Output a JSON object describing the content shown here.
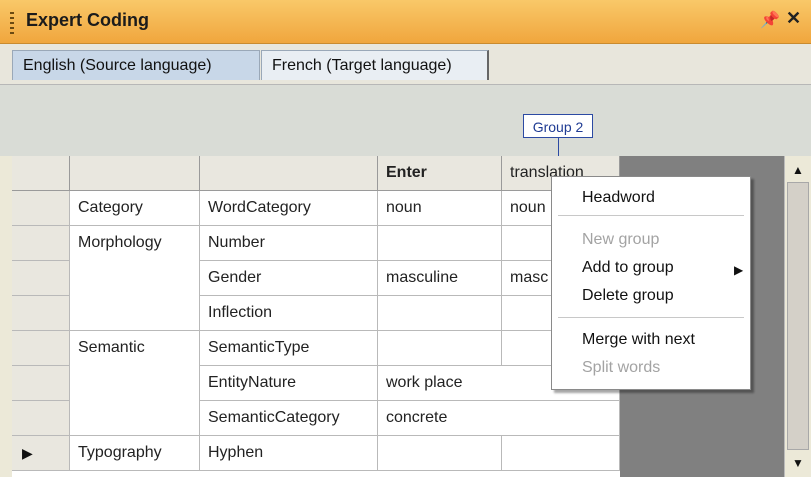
{
  "window": {
    "title": "Expert Coding",
    "pin_glyph": "1",
    "close_glyph": "✕"
  },
  "tabs": [
    {
      "label": "English (Source language)",
      "selected": true
    },
    {
      "label": "French (Target language)",
      "selected": false
    }
  ],
  "group_label": "Group 2",
  "grid": {
    "headers": [
      "",
      "",
      "",
      "Enter",
      "translation"
    ],
    "rows": [
      {
        "category": "Category",
        "attribute": "WordCategory",
        "source": "noun",
        "target": "noun",
        "pointer": false
      },
      {
        "category": "Morphology",
        "attribute": "Number",
        "source": "",
        "target": "",
        "pointer": false
      },
      {
        "category": "",
        "attribute": "Gender",
        "source": "masculine",
        "target": "masc",
        "pointer": false
      },
      {
        "category": "",
        "attribute": "Inflection",
        "source": "",
        "target": "",
        "pointer": false
      },
      {
        "category": "Semantic",
        "attribute": "SemanticType",
        "source": "",
        "target": "",
        "pointer": false
      },
      {
        "category": "",
        "attribute": "EntityNature",
        "source": "work place",
        "target": "",
        "pointer": false
      },
      {
        "category": "",
        "attribute": "SemanticCategory",
        "source": "concrete",
        "target": "",
        "pointer": false
      },
      {
        "category": "Typography",
        "attribute": "Hyphen",
        "source": "",
        "target": "",
        "pointer": true
      }
    ]
  },
  "context_menu": {
    "items": [
      {
        "label": "Headword",
        "disabled": false
      },
      {
        "label": "New group",
        "disabled": true
      },
      {
        "label": "Add to group",
        "disabled": false,
        "submenu": true
      },
      {
        "label": "Delete group",
        "disabled": false
      },
      {
        "label": "Merge with next",
        "disabled": false
      },
      {
        "label": "Split words",
        "disabled": true
      }
    ]
  },
  "icons": {
    "pointer": "▶",
    "submenu": "▶",
    "up": "▲",
    "down": "▼"
  },
  "colors": {
    "titlebar": "#f0a63d",
    "group_border": "#2c4aa3",
    "selected_tab": "#c8d7e8"
  }
}
